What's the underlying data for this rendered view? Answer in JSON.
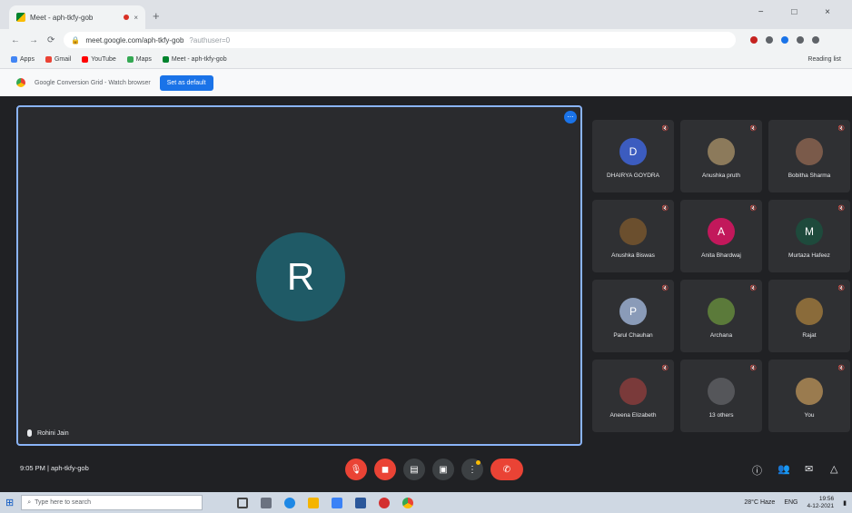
{
  "browser": {
    "tab_title": "Meet - aph-tkfy-gob",
    "tab_close": "×",
    "new_tab": "+",
    "url": "meet.google.com/aph-tkfy-gob",
    "url_suffix": "?authuser=0",
    "window_controls": "− □ ×",
    "bookmarks": [
      {
        "label": "Apps",
        "color": "#4285f4"
      },
      {
        "label": "Gmail",
        "color": "#ea4335"
      },
      {
        "label": "YouTube",
        "color": "#ff0000"
      },
      {
        "label": "Maps",
        "color": "#34a853"
      },
      {
        "label": "Meet - aph-tkfy-gob",
        "color": "#00832d"
      }
    ],
    "bookmarks_right": "Reading list",
    "infobar_text": "Google Conversion Grid - Watch browser",
    "infobar_button": "Set as default"
  },
  "meet": {
    "main_avatar_letter": "R",
    "main_name": "Rohini Jain",
    "more_icon": "⋯",
    "meeting_info": "9:05 PM | aph-tkfy-gob",
    "participants": [
      {
        "name": "DHAIRYA GOYDRA",
        "initial": "D",
        "color": "#3c5cbf"
      },
      {
        "name": "Anushka pruth",
        "initial": "",
        "color": "#8c7a5b"
      },
      {
        "name": "Bobitha Sharma",
        "initial": "",
        "color": "#7a5a4a"
      },
      {
        "name": "Anushka Biswas",
        "initial": "",
        "color": "#6b4f2e"
      },
      {
        "name": "Anita Bhardwaj",
        "initial": "A",
        "color": "#c2185b"
      },
      {
        "name": "Murtaza Hafeez",
        "initial": "M",
        "color": "#1e4a3c"
      },
      {
        "name": "Parul Chauhan",
        "initial": "P",
        "color": "#8a9bb8"
      },
      {
        "name": "Archana",
        "initial": "",
        "color": "#5b7a3a"
      },
      {
        "name": "Rajat",
        "initial": "",
        "color": "#8a6b3a"
      },
      {
        "name": "Aneena Elizabeth",
        "initial": "",
        "color": "#7a3a3a"
      },
      {
        "name": "13 others",
        "initial": "",
        "color": "#55565a"
      },
      {
        "name": "You",
        "initial": "",
        "color": "#9a7b4f"
      }
    ],
    "controls": {
      "mic_icon": "🎙",
      "cam_icon": "◼",
      "captions_icon": "▤",
      "present_icon": "▣",
      "more_icon": "⋮",
      "hangup_icon": "✆"
    },
    "right_controls": {
      "info_icon": "ⓘ",
      "people_icon": "👥",
      "chat_icon": "✉",
      "activities_icon": "△"
    }
  },
  "taskbar": {
    "search_placeholder": "Type here to search",
    "weather": "28°C Haze",
    "clock_time": "19:56",
    "clock_date": "4-12-2021",
    "language": "ENG"
  }
}
